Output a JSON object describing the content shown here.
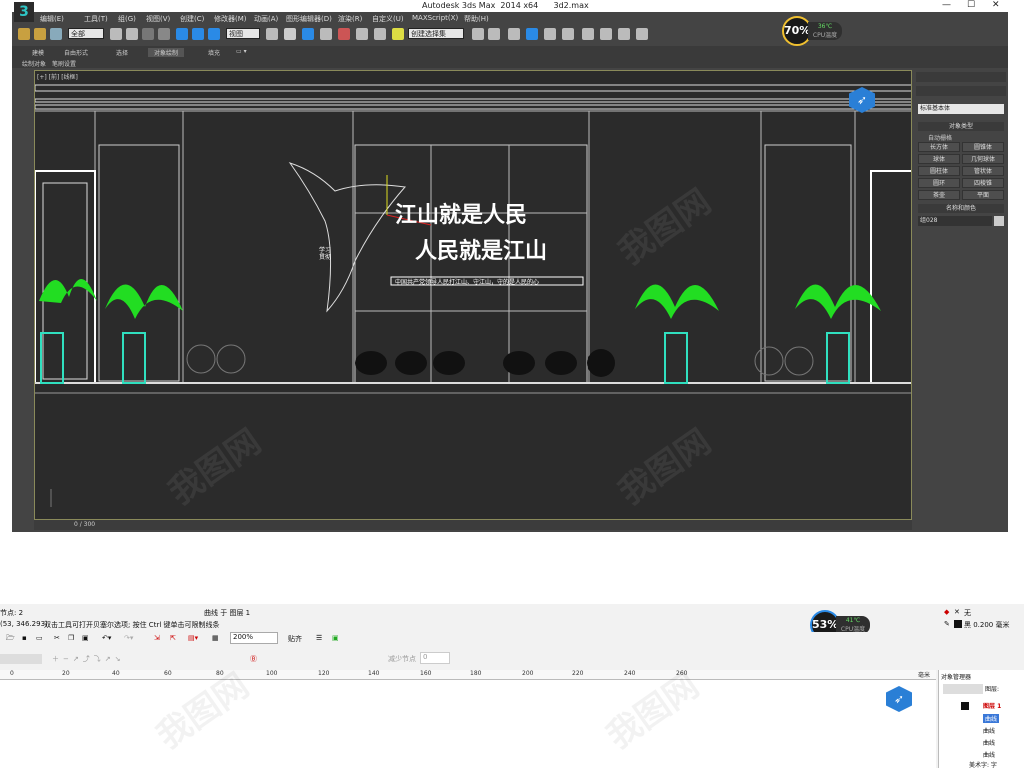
{
  "max": {
    "window_title": "Autodesk 3ds Max  2014 x64      3d2.max",
    "window_controls": [
      "—",
      "☐",
      "✕"
    ],
    "menu": [
      "编辑(E)",
      "工具(T)",
      "组(G)",
      "视图(V)",
      "创建(C)",
      "修改器(M)",
      "动画(A)",
      "图形编辑器(D)",
      "渲染(R)",
      "自定义(U)",
      "MAXScript(X)",
      "帮助(H)"
    ],
    "toolbar": {
      "selection_filter": "全部",
      "coord_system": "视图",
      "named_selection": "创建选择集"
    },
    "ribbon_tabs": [
      "建模",
      "自由形式",
      "选择",
      "对象绘制",
      "填充"
    ],
    "ribbon_sub": [
      "绘制对象",
      "笔刷设置"
    ],
    "viewport_label": "[+] [前] [线框]",
    "timeline": "0 / 300",
    "command_panel": {
      "dropdown": "标准基本体",
      "object_type_title": "对象类型",
      "autogrid": "自动栅格",
      "primitives": [
        "长方体",
        "圆锥体",
        "球体",
        "几何球体",
        "圆柱体",
        "管状体",
        "圆环",
        "四棱锥",
        "茶壶",
        "平面"
      ],
      "name_color_title": "名称和颜色",
      "object_name": "组028"
    },
    "scene_text": {
      "slogan_line1": "江山就是人民",
      "slogan_line2": "人民就是江山",
      "subtitle": "中国共产党领导人民打江山、守江山，守的是人民的心",
      "seal": "学习贯彻"
    }
  },
  "cpu_widget_top": {
    "percent": "70%",
    "temp": "36℃",
    "label": "CPU温度"
  },
  "cpu_widget_bottom": {
    "percent": "53%",
    "temp": "41℃",
    "label": "CPU温度"
  },
  "coreldraw": {
    "status_left_top": "节点: 2",
    "status_coords": "(53, 346.293)",
    "status_hint": "双击工具可打开贝塞尔选项; 按住 Ctrl 键单击可限制线条",
    "status_layer": "曲线 于 图层 1",
    "fill_label": "无",
    "outline_label": "黑  0.200 毫米",
    "zoom": "200%",
    "snap_label": "贴齐",
    "reduce_nodes_label": "减少节点",
    "reduce_nodes_value": "0",
    "ruler_ticks": [
      "0",
      "20",
      "40",
      "60",
      "80",
      "100",
      "120",
      "140",
      "160",
      "180",
      "200",
      "220",
      "240",
      "260"
    ],
    "ruler_unit": "毫米",
    "object_manager": {
      "title": "对象管理器",
      "header_right": "图层:",
      "layer": "图层 1",
      "items": [
        "曲线",
        "曲线",
        "曲线",
        "曲线",
        "美术字: 字"
      ]
    }
  },
  "colors": {
    "max_bg": "#444444",
    "viewport_bg": "#2b2b2b",
    "plant_green": "#22dd22",
    "vase_teal": "#30e0c0",
    "accent_blue": "#2a7fd6",
    "cpu_ring": "#f0c030"
  },
  "watermark": "我图网"
}
